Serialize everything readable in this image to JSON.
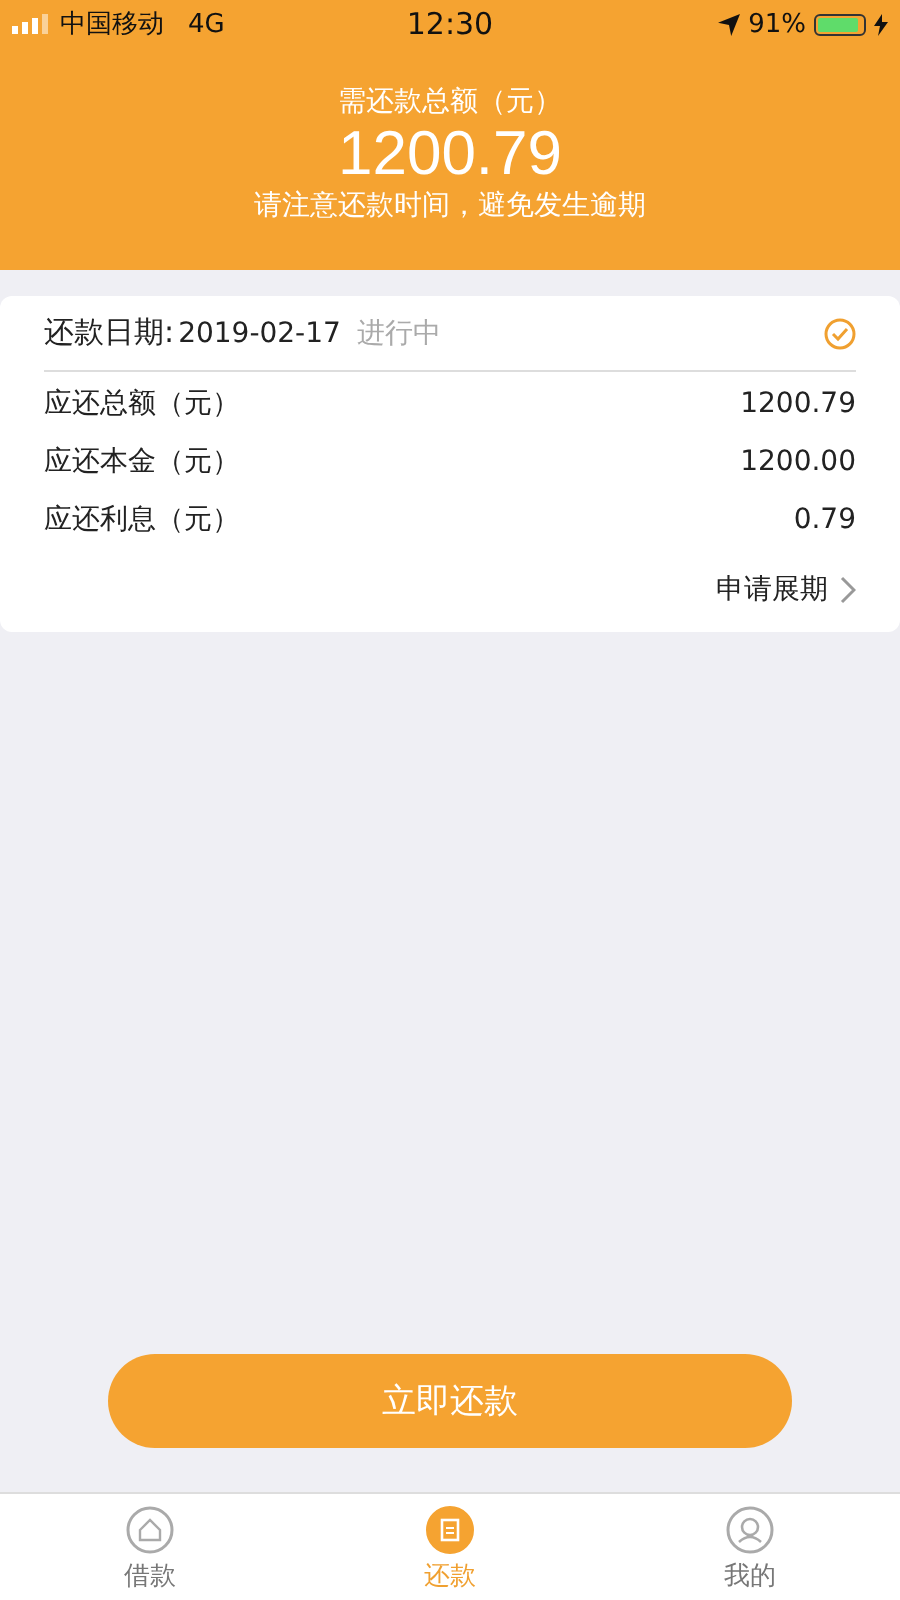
{
  "status_bar": {
    "carrier": "中国移动",
    "network": "4G",
    "time": "12:30",
    "battery_percent": "91%"
  },
  "header": {
    "label": "需还款总额（元）",
    "amount": "1200.79",
    "notice": "请注意还款时间，避免发生逾期"
  },
  "card": {
    "date_label": "还款日期:",
    "date": "2019-02-17",
    "status": "进行中",
    "rows": [
      {
        "label": "应还总额（元）",
        "value": "1200.79"
      },
      {
        "label": "应还本金（元）",
        "value": "1200.00"
      },
      {
        "label": "应还利息（元）",
        "value": "0.79"
      }
    ],
    "extend_link": "申请展期"
  },
  "repay_button": "立即还款",
  "tabs": [
    {
      "kind": "house",
      "label": "借款",
      "selected": false
    },
    {
      "kind": "document",
      "label": "还款",
      "selected": true
    },
    {
      "kind": "person",
      "label": "我的",
      "selected": false
    }
  ]
}
